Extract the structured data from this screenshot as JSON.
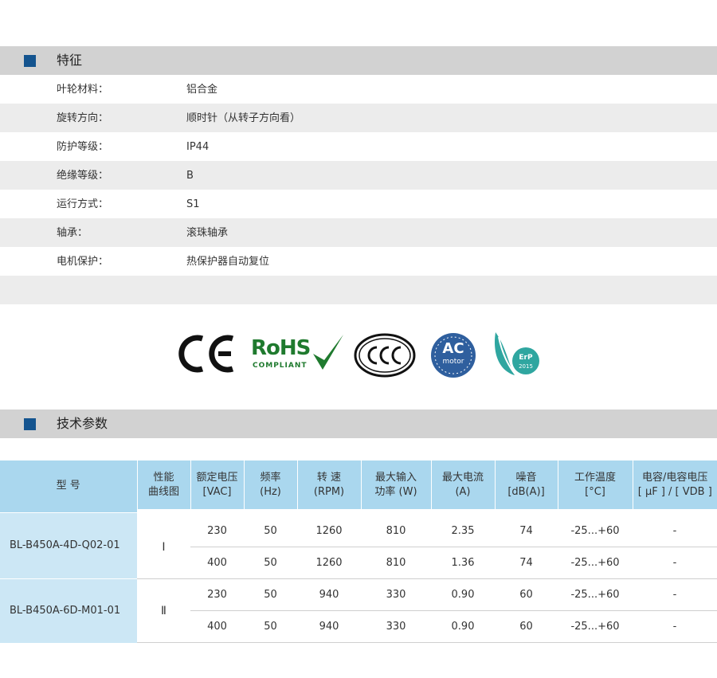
{
  "features_section": {
    "title": "特征",
    "rows": [
      {
        "label": "叶轮材料：",
        "value": "铝合金"
      },
      {
        "label": "旋转方向：",
        "value": "顺时针（从转子方向看）"
      },
      {
        "label": "防护等级：",
        "value": "IP44"
      },
      {
        "label": "绝缘等级：",
        "value": "B"
      },
      {
        "label": "运行方式：",
        "value": "S1"
      },
      {
        "label": "轴承：",
        "value": "滚珠轴承"
      },
      {
        "label": "电机保护：",
        "value": "热保护器自动复位"
      }
    ]
  },
  "certifications": {
    "ce": "CE",
    "rohs": "RoHS",
    "rohs_sub": "COMPLIANT",
    "ccc": "CCC",
    "ac_main": "AC",
    "ac_sub": "motor",
    "erp_main": "ErP",
    "erp_year": "2015",
    "colors": {
      "rohs_green": "#1f7a2e",
      "ac_blue": "#2f5f9e",
      "erp_teal": "#2fa6a0"
    }
  },
  "spec_section": {
    "title": "技术参数",
    "headers": [
      {
        "line1": "型 号",
        "line2": ""
      },
      {
        "line1": "性能",
        "line2": "曲线图"
      },
      {
        "line1": "额定电压",
        "line2": "[VAC]"
      },
      {
        "line1": "频率",
        "line2": "(Hz)"
      },
      {
        "line1": "转 速",
        "line2": "(RPM)"
      },
      {
        "line1": "最大输入",
        "line2": "功率 (W)"
      },
      {
        "line1": "最大电流",
        "line2": "(A)"
      },
      {
        "line1": "噪音",
        "line2": "[dB(A)]"
      },
      {
        "line1": "工作温度",
        "line2": "[°C]"
      },
      {
        "line1": "电容/电容电压",
        "line2": "[ μF ] / [ VDB ]"
      }
    ],
    "models": [
      {
        "model": "BL-B450A-4D-Q02-01",
        "curve": "Ⅰ",
        "rows": [
          {
            "voltage": "230",
            "freq": "50",
            "rpm": "1260",
            "power": "810",
            "current": "2.35",
            "noise": "74",
            "temp": "-25...+60",
            "cap": "-"
          },
          {
            "voltage": "400",
            "freq": "50",
            "rpm": "1260",
            "power": "810",
            "current": "1.36",
            "noise": "74",
            "temp": "-25...+60",
            "cap": "-"
          }
        ]
      },
      {
        "model": "BL-B450A-6D-M01-01",
        "curve": "Ⅱ",
        "rows": [
          {
            "voltage": "230",
            "freq": "50",
            "rpm": "940",
            "power": "330",
            "current": "0.90",
            "noise": "60",
            "temp": "-25...+60",
            "cap": "-"
          },
          {
            "voltage": "400",
            "freq": "50",
            "rpm": "940",
            "power": "330",
            "current": "0.90",
            "noise": "60",
            "temp": "-25...+60",
            "cap": "-"
          }
        ]
      }
    ]
  }
}
